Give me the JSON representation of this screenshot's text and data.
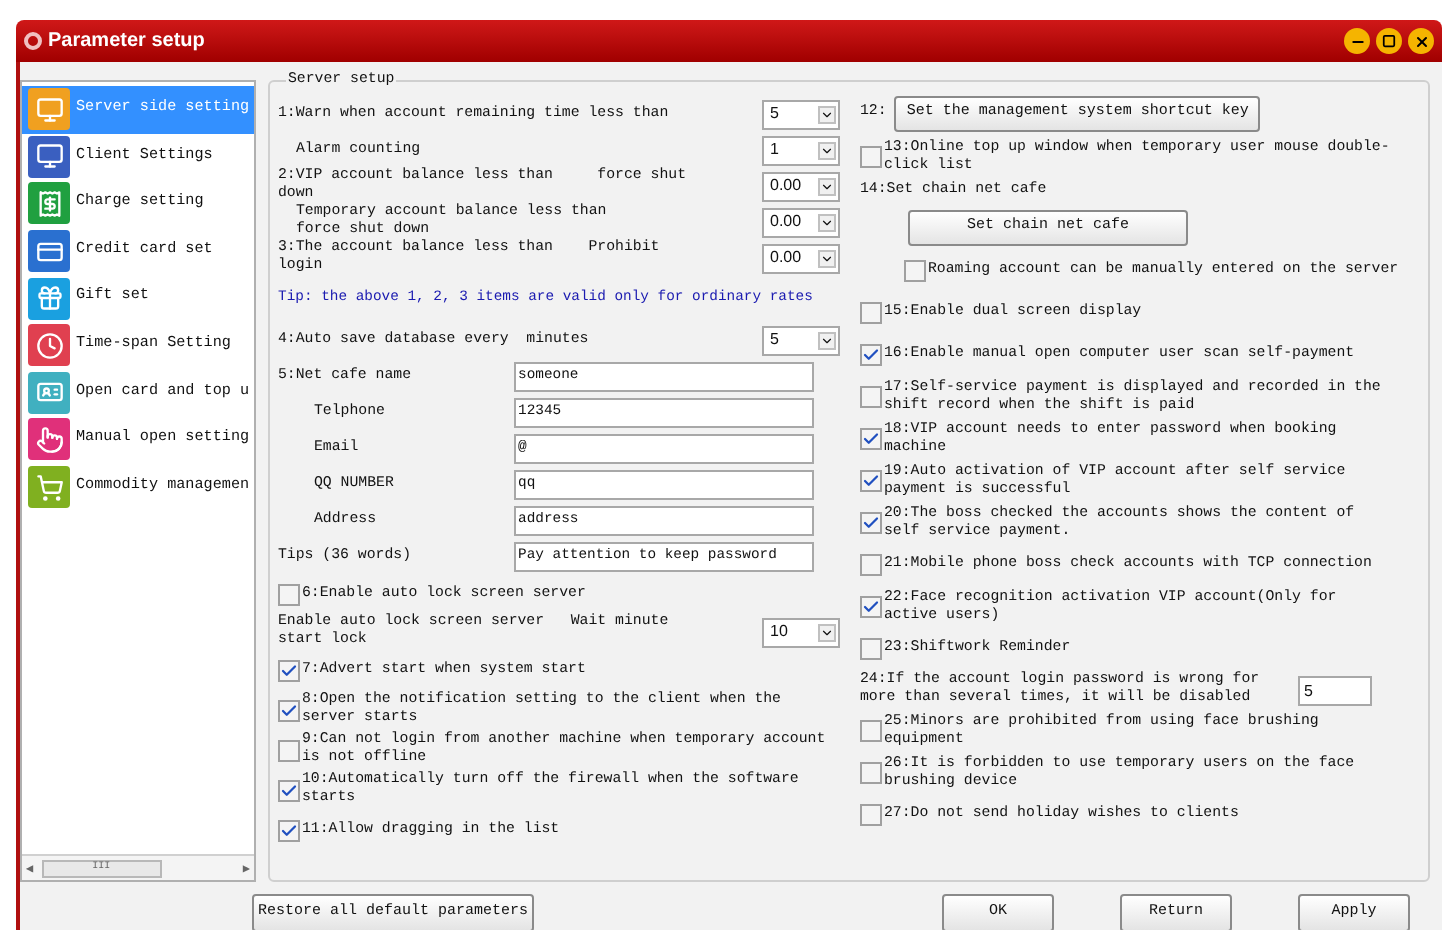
{
  "window": {
    "title": "Parameter setup"
  },
  "sidebar": {
    "items": [
      {
        "label": "Server side setting",
        "selected": true
      },
      {
        "label": "Client Settings",
        "selected": false
      },
      {
        "label": "Charge setting",
        "selected": false
      },
      {
        "label": "Credit card set",
        "selected": false
      },
      {
        "label": "Gift set",
        "selected": false
      },
      {
        "label": "Time-span Setting",
        "selected": false
      },
      {
        "label": "Open card and top u",
        "selected": false
      },
      {
        "label": "Manual open setting",
        "selected": false
      },
      {
        "label": "Commodity managemen",
        "selected": false
      }
    ],
    "scrollbar_grip": "III",
    "scroll_left": "◀",
    "scroll_right": "▶"
  },
  "group": {
    "title": "Server setup"
  },
  "left_items": [
    {
      "kind": "combo",
      "label": "1:Warn when account remaining time less than",
      "value": "5",
      "sub": false
    },
    {
      "kind": "combo",
      "label": "Alarm counting",
      "value": "1",
      "sub": true
    },
    {
      "kind": "combo",
      "label": "2:VIP account balance less than     force shut down",
      "value": "0.00",
      "sub": false
    },
    {
      "kind": "combo",
      "label": "Temporary account balance less than     force shut down",
      "value": "0.00",
      "sub": true
    },
    {
      "kind": "combo",
      "label": "3:The account balance less than    Prohibit login",
      "value": "0.00",
      "sub": false
    },
    {
      "kind": "tip",
      "label": "Tip: the above 1, 2, 3 items are valid only for ordinary rates"
    },
    {
      "kind": "combo",
      "label": "4:Auto save database every  minutes",
      "value": "5",
      "sub": false
    },
    {
      "kind": "field",
      "label": "5:Net cafe name",
      "value": "someone",
      "sub": false
    },
    {
      "kind": "field",
      "label": "Telphone",
      "value": "12345",
      "sub": true
    },
    {
      "kind": "field",
      "label": "Email",
      "value": "@",
      "sub": true
    },
    {
      "kind": "field",
      "label": "QQ NUMBER",
      "value": "qq",
      "sub": true
    },
    {
      "kind": "field",
      "label": "Address",
      "value": "address",
      "sub": true
    },
    {
      "kind": "field",
      "label": "Tips (36 words)",
      "value": "Pay attention to keep password",
      "sub": false
    },
    {
      "kind": "checkbox",
      "label": "6:Enable auto lock screen server",
      "checked": false
    },
    {
      "kind": "combo",
      "label": "Enable auto lock screen server   Wait minute start lock",
      "value": "10",
      "sub": false
    },
    {
      "kind": "checkbox",
      "label": "7:Advert start when system start",
      "checked": true
    },
    {
      "kind": "checkbox",
      "label": "8:Open the notification setting to the client when the server starts",
      "checked": true
    },
    {
      "kind": "checkbox",
      "label": "9:Can not login from another machine when temporary account is not offline",
      "checked": false
    },
    {
      "kind": "checkbox",
      "label": "10:Automatically turn off the firewall when the software starts",
      "checked": true
    },
    {
      "kind": "checkbox",
      "label": "11:Allow dragging in the list",
      "checked": true
    }
  ],
  "right_items": [
    {
      "kind": "button",
      "label": "12:",
      "button": "Set the management system shortcut key"
    },
    {
      "kind": "checkbox",
      "label": "13:Online top up window when temporary user mouse double-click list",
      "checked": false
    },
    {
      "kind": "label",
      "label": "14:Set chain net cafe"
    },
    {
      "kind": "button",
      "button": "Set chain net cafe"
    },
    {
      "kind": "sub-checkbox",
      "label": "Roaming account can be manually entered on the server",
      "checked": false
    },
    {
      "kind": "checkbox",
      "label": "15:Enable dual screen display",
      "checked": false
    },
    {
      "kind": "checkbox",
      "label": "16:Enable manual open computer user scan self-payment",
      "checked": true
    },
    {
      "kind": "checkbox",
      "label": "17:Self-service payment is displayed and recorded in the shift record when the shift is paid",
      "checked": false
    },
    {
      "kind": "checkbox",
      "label": "18:VIP account needs to enter password when booking machine",
      "checked": true
    },
    {
      "kind": "checkbox",
      "label": "19:Auto activation of VIP account after self service payment is successful",
      "checked": true
    },
    {
      "kind": "checkbox",
      "label": "20:The boss checked the accounts shows the content of self service payment.",
      "checked": true
    },
    {
      "kind": "checkbox",
      "label": "21:Mobile phone boss check accounts with TCP connection",
      "checked": false
    },
    {
      "kind": "checkbox",
      "label": "22:Face recognition activation VIP account(Only for active users)",
      "checked": true
    },
    {
      "kind": "checkbox",
      "label": "23:Shiftwork Reminder",
      "checked": false
    },
    {
      "kind": "number",
      "label": "24:If the account login password is wrong for more than several times, it will be disabled",
      "value": "5"
    },
    {
      "kind": "checkbox",
      "label": "25:Minors are prohibited from using face brushing equipment",
      "checked": false
    },
    {
      "kind": "checkbox",
      "label": "26:It is forbidden to use temporary users on the face brushing device",
      "checked": false
    },
    {
      "kind": "checkbox",
      "label": "27:Do not send holiday wishes to clients",
      "checked": false
    }
  ],
  "footer": {
    "restore": "Restore all default parameters",
    "buttons": [
      "OK",
      "Return",
      "Apply"
    ]
  }
}
